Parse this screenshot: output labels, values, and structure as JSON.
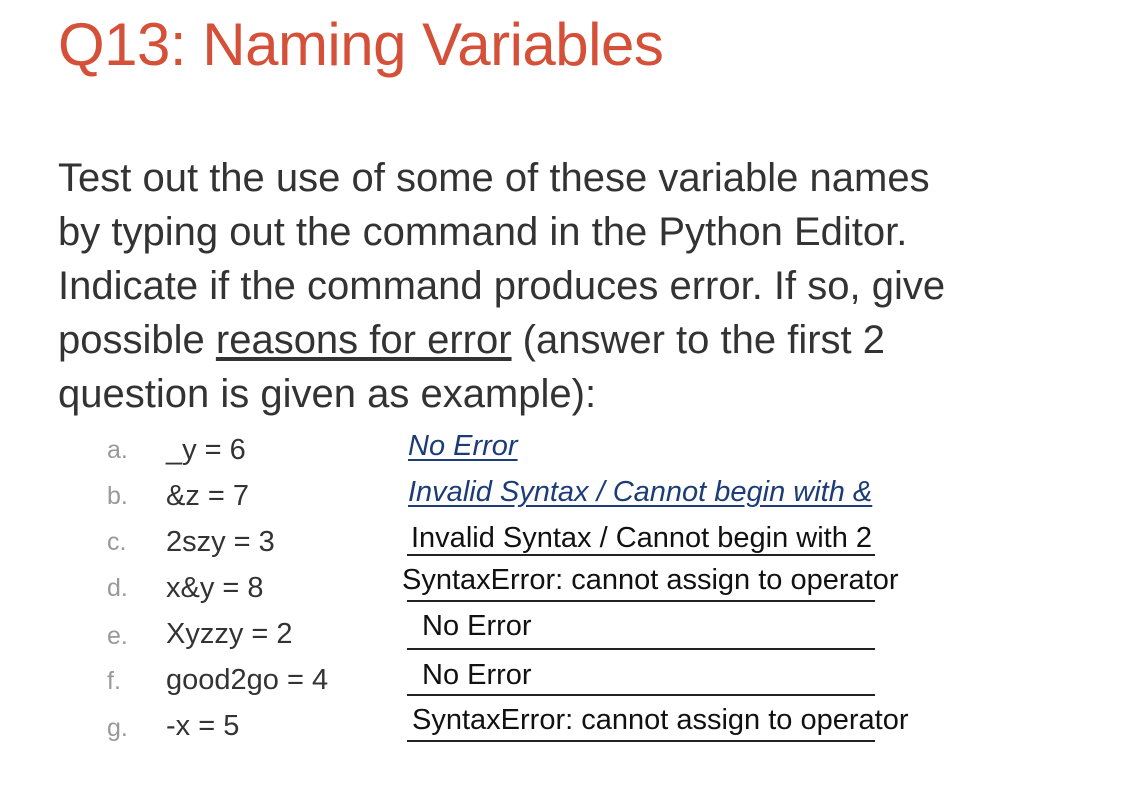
{
  "title": "Q13: Naming Variables",
  "instructions": {
    "line1": "Test out the use of some of these variable names",
    "line2": "by typing out the command in the Python Editor.",
    "line3": "Indicate if the command produces error. If so, give",
    "line4_pre": "possible ",
    "line4_underlined": "reasons for error",
    "line4_post": " (answer to the first 2",
    "line5": "question is given as example):"
  },
  "items": [
    {
      "letter": "a.",
      "expression": "_y = 6",
      "answer": "No Error"
    },
    {
      "letter": "b.",
      "expression": "&z = 7",
      "answer": "Invalid Syntax / Cannot begin with &"
    },
    {
      "letter": "c.",
      "expression": "2szy = 3",
      "answer": "Invalid Syntax / Cannot begin with 2"
    },
    {
      "letter": "d.",
      "expression": "x&y = 8",
      "answer": "SyntaxError: cannot assign to operator"
    },
    {
      "letter": "e.",
      "expression": "Xyzzy = 2",
      "answer": "No Error"
    },
    {
      "letter": "f.",
      "expression": "good2go = 4",
      "answer": "No Error"
    },
    {
      "letter": "g.",
      "expression": "-x = 5",
      "answer": "SyntaxError: cannot assign to operator"
    }
  ],
  "colors": {
    "title": "#d55038",
    "body_text": "#333333",
    "list_marker": "#999999",
    "example_answer": "#1c3c78",
    "student_answer": "#111111"
  }
}
